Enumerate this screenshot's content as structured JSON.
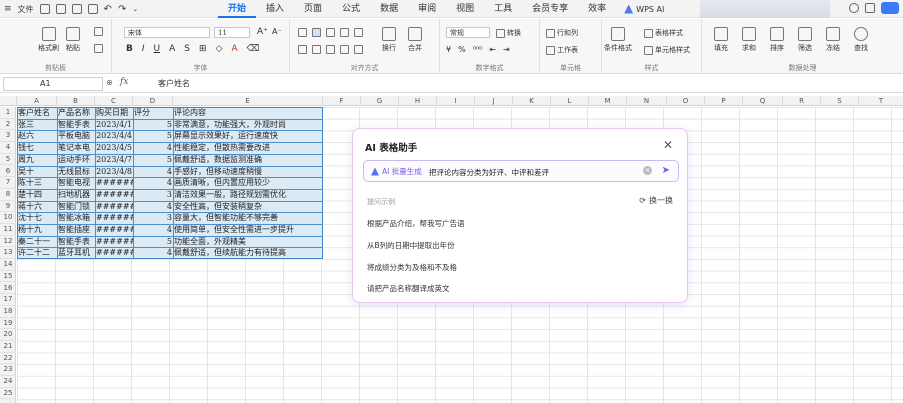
{
  "menubar": {
    "file_label": "文件",
    "tabs": [
      {
        "label": "开始",
        "active": true
      },
      {
        "label": "插入"
      },
      {
        "label": "页面"
      },
      {
        "label": "公式"
      },
      {
        "label": "数据"
      },
      {
        "label": "审阅"
      },
      {
        "label": "视图"
      },
      {
        "label": "工具"
      },
      {
        "label": "会员专享"
      },
      {
        "label": "效率"
      }
    ],
    "wps_ai_label": "WPS AI"
  },
  "ribbon": {
    "clipboard": {
      "brush": "格式刷",
      "paste": "粘贴",
      "group_label": "剪贴板"
    },
    "font": {
      "name": "宋体",
      "size": "11",
      "group_label": "字体"
    },
    "align": {
      "wrap": "换行",
      "merge": "合并",
      "group_label": "对齐方式"
    },
    "number": {
      "format": "常规",
      "convert": "转换",
      "group_label": "数字格式"
    },
    "cells": {
      "rowcol": "行和列",
      "worksheet": "工作表",
      "group_label": "单元格"
    },
    "style": {
      "cond": "条件格式",
      "table": "表格样式",
      "cell": "单元格样式",
      "group_label": "样式"
    },
    "data": {
      "fill": "填充",
      "sum": "求和",
      "sort": "排序",
      "filter": "筛选",
      "freeze": "冻结",
      "find": "查找",
      "group_label": "数据处理"
    }
  },
  "formula_bar": {
    "cell_ref": "A1",
    "content": "客户姓名"
  },
  "columns": [
    "A",
    "B",
    "C",
    "D",
    "E",
    "F",
    "G",
    "H",
    "I",
    "J",
    "K",
    "L",
    "M",
    "N",
    "O",
    "P",
    "Q",
    "R",
    "S",
    "T"
  ],
  "rows": [
    "1",
    "2",
    "3",
    "4",
    "5",
    "6",
    "7",
    "8",
    "9",
    "10",
    "11",
    "12",
    "13",
    "14",
    "15",
    "16",
    "17",
    "18",
    "19",
    "20",
    "21",
    "22",
    "23",
    "24",
    "25"
  ],
  "sheet": {
    "header": [
      "客户姓名",
      "产品名称",
      "购买日期",
      "评分",
      "评论内容"
    ],
    "rows": [
      [
        "张三",
        "智能手表",
        "2023/4/1",
        "5",
        "非常满意，功能强大，外观时尚"
      ],
      [
        "赵六",
        "平板电脑",
        "2023/4/4",
        "5",
        "屏幕显示效果好，运行速度快"
      ],
      [
        "钱七",
        "笔记本电",
        "2023/4/5",
        "4",
        "性能稳定，但散热需要改进"
      ],
      [
        "周九",
        "运动手环",
        "2023/4/7",
        "5",
        "佩戴舒适，数据监测准确"
      ],
      [
        "吴十",
        "无线鼠标",
        "2023/4/8",
        "4",
        "手感好，但移动速度稍慢"
      ],
      [
        "陈十三",
        "智能电视",
        "########",
        "4",
        "画质清晰，但内置应用较少"
      ],
      [
        "楚十四",
        "扫地机器",
        "########",
        "3",
        "清洁效果一般，路径规划需优化"
      ],
      [
        "蒋十六",
        "智能门锁",
        "########",
        "4",
        "安全性高，但安装稍复杂"
      ],
      [
        "沈十七",
        "智能冰箱",
        "########",
        "3",
        "容量大，但智能功能不够完善"
      ],
      [
        "杨十九",
        "智能插座",
        "########",
        "4",
        "使用简单，但安全性需进一步提升"
      ],
      [
        "秦二十一",
        "智能手表",
        "########",
        "5",
        "功能全面，外观精美"
      ],
      [
        "许二十二",
        "蓝牙耳机",
        "########",
        "4",
        "佩戴舒适，但续航能力有待提高"
      ]
    ]
  },
  "ai_dialog": {
    "title": "AI 表格助手",
    "badge": "AI 批量生成",
    "query": "把评论内容分类为好评、中评和差评",
    "hint": "提问示例",
    "refresh": "换一换",
    "examples": [
      "根据产品介绍，帮我写广告语",
      "从B列的日期中提取出年份",
      "将成绩分类为及格和不及格",
      "请把产品名称翻译成英文"
    ]
  }
}
